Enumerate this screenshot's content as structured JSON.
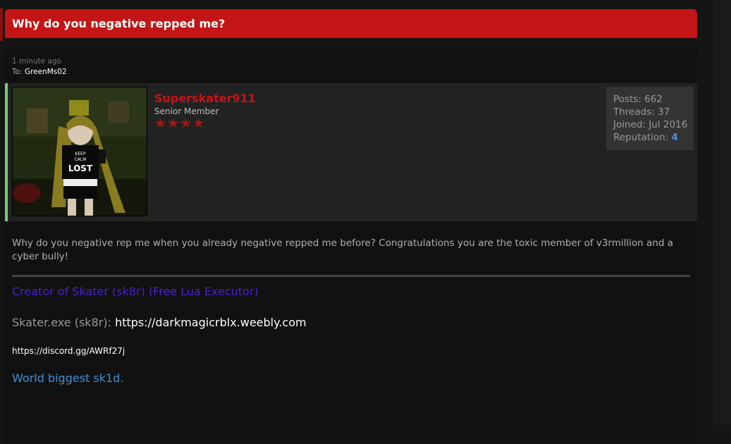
{
  "thread": {
    "title": "Why do you negative repped me?"
  },
  "message": {
    "time": "1 minute ago",
    "to_label": "To:",
    "to_user": "GreenMs02",
    "body": "Why do you negative rep me when you already negative repped me before? Congratulations you are the toxic member of v3rmillion and a cyber bully!"
  },
  "author": {
    "name": "Superskater911",
    "title": "Senior Member",
    "stars": "★★★★",
    "avatar_text": {
      "line1": "KEEP",
      "line2": "CALM",
      "line3": "LOST"
    },
    "stats": {
      "posts_label": "Posts:",
      "posts": "662",
      "threads_label": "Threads:",
      "threads": "37",
      "joined_label": "Joined:",
      "joined": "Jul 2016",
      "reputation_label": "Reputation:",
      "reputation": "4"
    }
  },
  "signature": {
    "creator": "Creator of Skater (sk8r) (Free Lua Executor)",
    "skater_label": "Skater.exe (sk8r):",
    "skater_url": "https://darkmagicrblx.weebly.com",
    "discord": "https://discord.gg/AWRf27j",
    "tagline": "World biggest sk1d."
  },
  "colors": {
    "accent": "#c41516",
    "online": "#6ed36e",
    "link": "#3b8fd6",
    "creator_link": "#4b1fd6"
  }
}
